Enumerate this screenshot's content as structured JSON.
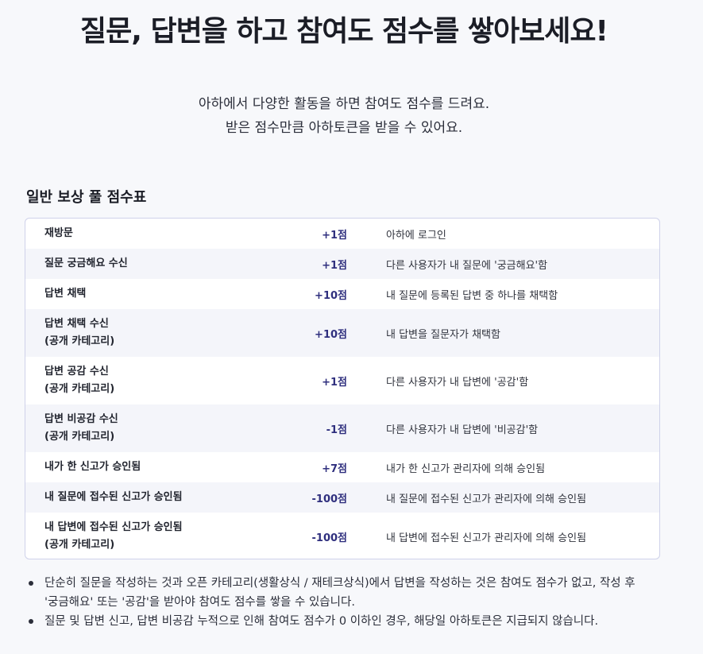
{
  "hero": {
    "title": "질문, 답변을 하고 참여도 점수를 쌓아보세요!",
    "desc_line1": "아하에서 다양한 활동을 하면 참여도 점수를 드려요.",
    "desc_line2": "받은 점수만큼 아하토큰을 받을 수 있어요."
  },
  "table": {
    "title": "일반 보상 풀 점수표",
    "rows": [
      {
        "activity": "재방문",
        "activity_sub": "",
        "points": "+1점",
        "description": "아하에 로그인"
      },
      {
        "activity": "질문 궁금해요 수신",
        "activity_sub": "",
        "points": "+1점",
        "description": "다른 사용자가 내 질문에 '궁금해요'함"
      },
      {
        "activity": "답변 채택",
        "activity_sub": "",
        "points": "+10점",
        "description": "내 질문에 등록된 답변 중 하나를 채택함"
      },
      {
        "activity": "답변 채택 수신",
        "activity_sub": "(공개 카테고리)",
        "points": "+10점",
        "description": "내 답변을 질문자가 채택함"
      },
      {
        "activity": "답변 공감 수신",
        "activity_sub": "(공개 카테고리)",
        "points": "+1점",
        "description": "다른 사용자가 내 답변에 '공감'함"
      },
      {
        "activity": "답변 비공감 수신",
        "activity_sub": "(공개 카테고리)",
        "points": "-1점",
        "description": "다른 사용자가 내 답변에 '비공감'함"
      },
      {
        "activity": "내가 한 신고가 승인됨",
        "activity_sub": "",
        "points": "+7점",
        "description": "내가 한 신고가 관리자에 의해 승인됨"
      },
      {
        "activity": "내 질문에 접수된 신고가 승인됨",
        "activity_sub": "",
        "points": "-100점",
        "description": "내 질문에 접수된 신고가 관리자에 의해 승인됨"
      },
      {
        "activity": "내 답변에 접수된 신고가 승인됨",
        "activity_sub": "(공개 카테고리)",
        "points": "-100점",
        "description": "내 답변에 접수된 신고가 관리자에 의해 승인됨"
      }
    ]
  },
  "notes": {
    "note1_line1": "단순히 질문을 작성하는 것과 오픈 카테고리(생활상식 / 재테크상식)에서 답변을 작성하는 것은 참여도 점수가 없고, 작성 후",
    "note1_line2": "'궁금해요' 또는 '공감'을 받아야 참여도 점수를 쌓을 수 있습니다.",
    "note2": "질문 및 답변 신고, 답변 비공감 누적으로 인해 참여도 점수가 0 이하인 경우, 해당일 아하토큰은 지급되지 않습니다."
  },
  "colors": {
    "page_bg": "#f7f8fb",
    "table_border": "#cfd2ea",
    "alt_row_bg": "#f4f5fa",
    "points_color": "#2f2f7e"
  }
}
